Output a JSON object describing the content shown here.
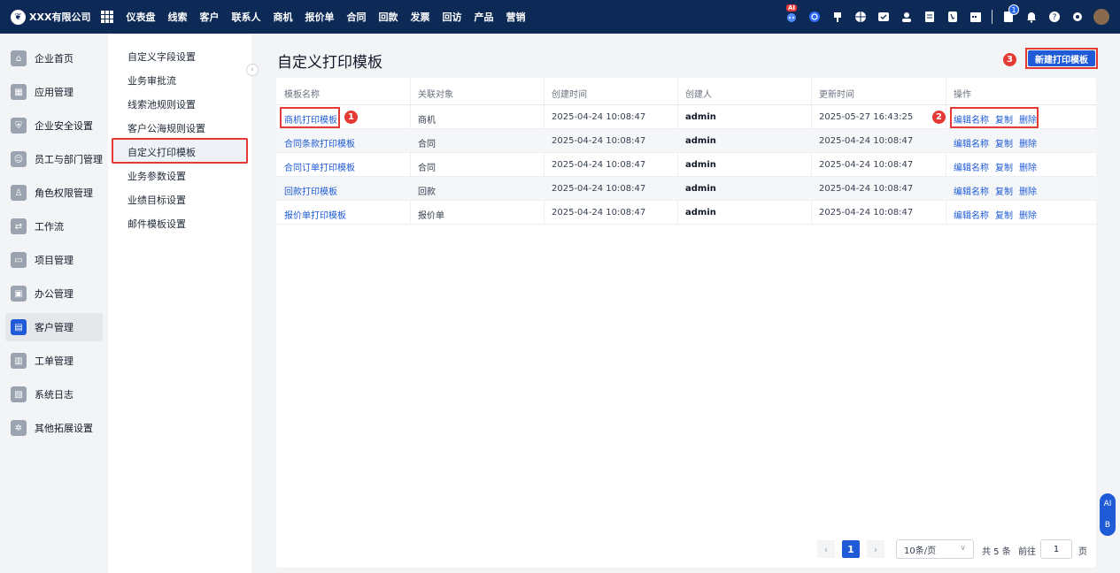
{
  "header": {
    "company": "XXX有限公司",
    "nav": [
      "仪表盘",
      "线索",
      "客户",
      "联系人",
      "商机",
      "报价单",
      "合同",
      "回款",
      "发票",
      "回访",
      "产品",
      "营销"
    ],
    "ai_badge": "AI",
    "notification_count": "1"
  },
  "sidebar": {
    "items": [
      {
        "label": "企业首页",
        "icon": "home-icon"
      },
      {
        "label": "应用管理",
        "icon": "apps-icon"
      },
      {
        "label": "企业安全设置",
        "icon": "shield-icon"
      },
      {
        "label": "员工与部门管理",
        "icon": "users-icon"
      },
      {
        "label": "角色权限管理",
        "icon": "user-icon"
      },
      {
        "label": "工作流",
        "icon": "workflow-icon"
      },
      {
        "label": "项目管理",
        "icon": "folder-icon"
      },
      {
        "label": "办公管理",
        "icon": "briefcase-icon"
      },
      {
        "label": "客户管理",
        "icon": "customer-icon",
        "active": true
      },
      {
        "label": "工单管理",
        "icon": "ticket-icon"
      },
      {
        "label": "系统日志",
        "icon": "log-icon"
      },
      {
        "label": "其他拓展设置",
        "icon": "settings-icon"
      }
    ]
  },
  "submenu": {
    "items": [
      "自定义字段设置",
      "业务审批流",
      "线索池规则设置",
      "客户公海规则设置",
      "自定义打印模板",
      "业务参数设置",
      "业绩目标设置",
      "邮件模板设置"
    ],
    "active": "自定义打印模板"
  },
  "main": {
    "title": "自定义打印模板",
    "new_button": "新建打印模板",
    "markers": [
      "1",
      "2",
      "3"
    ],
    "columns": [
      "模板名称",
      "关联对象",
      "创建时间",
      "创建人",
      "更新时间",
      "操作"
    ],
    "rows": [
      {
        "name": "商机打印模板",
        "object": "商机",
        "created": "2025-04-24 10:08:47",
        "creator": "admin",
        "updated": "2025-05-27 16:43:25"
      },
      {
        "name": "合同条款打印模板",
        "object": "合同",
        "created": "2025-04-24 10:08:47",
        "creator": "admin",
        "updated": "2025-04-24 10:08:47"
      },
      {
        "name": "合同订单打印模板",
        "object": "合同",
        "created": "2025-04-24 10:08:47",
        "creator": "admin",
        "updated": "2025-04-24 10:08:47"
      },
      {
        "name": "回款打印模板",
        "object": "回款",
        "created": "2025-04-24 10:08:47",
        "creator": "admin",
        "updated": "2025-04-24 10:08:47"
      },
      {
        "name": "报价单打印模板",
        "object": "报价单",
        "created": "2025-04-24 10:08:47",
        "creator": "admin",
        "updated": "2025-04-24 10:08:47"
      }
    ],
    "actions": [
      "编辑名称",
      "复制",
      "删除"
    ]
  },
  "pagination": {
    "current_page": "1",
    "page_size": "10条/页",
    "total": "共 5 条",
    "goto_label": "前往",
    "goto_value": "1",
    "page_suffix": "页"
  },
  "float": {
    "top": "AI",
    "bottom": "B"
  }
}
